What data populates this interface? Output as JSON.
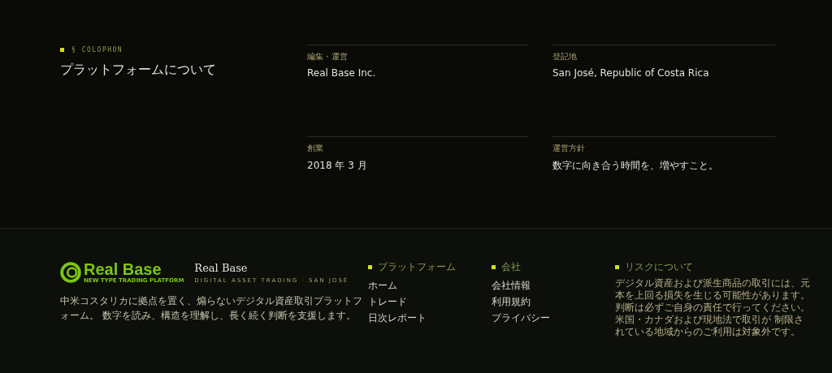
{
  "colophon": {
    "eyebrow": "§ COLOPHON",
    "heading": "プラットフォームについて",
    "facts": [
      {
        "label": "編集・運営",
        "value": "Real Base Inc."
      },
      {
        "label": "登記地",
        "value": "San José, Republic of Costa Rica"
      },
      {
        "label": "創業",
        "value": "2018 年 3 月"
      },
      {
        "label": "運営方針",
        "value": "数字に向き合う時間を、増やすこと。"
      }
    ]
  },
  "footer": {
    "logo": {
      "wordmark": "Real Base",
      "tagline": "NEW TYPE TRADING PLATFORM"
    },
    "brand_name": "Real Base",
    "brand_sub": "DIGITAL ASSET TRADING · SAN JOSÉ",
    "description": "中米コスタリカに拠点を置く、煽らないデジタル資産取引プラットフォーム。 数字を読み、構造を理解し、長く続く判断を支援します。",
    "columns": [
      {
        "title": "プラットフォーム",
        "links": [
          "ホーム",
          "トレード",
          "日次レポート"
        ]
      },
      {
        "title": "会社",
        "links": [
          "会社情報",
          "利用規約",
          "プライバシー"
        ]
      }
    ],
    "risk": {
      "title": "リスクについて",
      "text": "デジタル資産および派生商品の取引には、元本を上回る損失を生じる可能性があります。判断は必ずご自身の責任で行ってください。米国・カナダおよび現地法で取引が 制限されている地域からのご利用は対象外です。"
    }
  }
}
